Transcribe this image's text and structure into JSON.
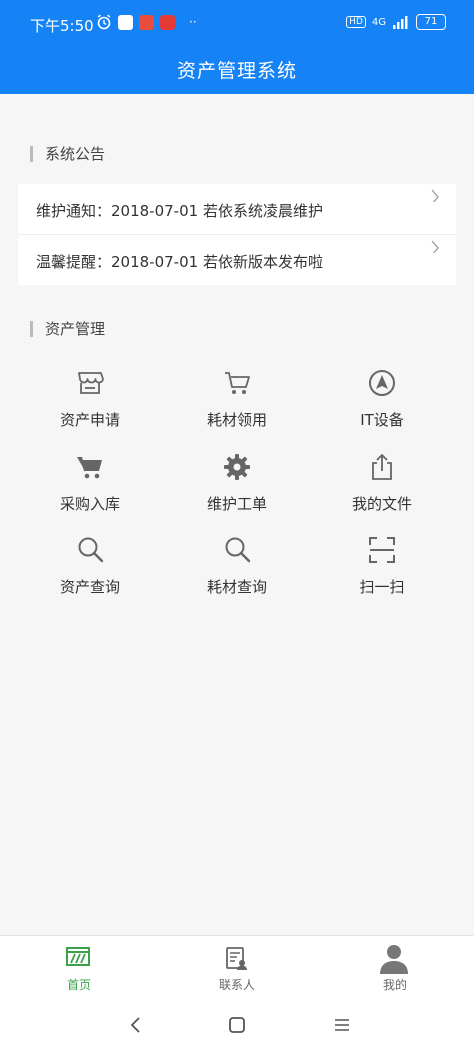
{
  "status": {
    "time": "下午5:50",
    "network": "4G",
    "battery": "71"
  },
  "app": {
    "title": "资产管理系统"
  },
  "notices": {
    "section_title": "系统公告",
    "items": [
      {
        "text": "维护通知：2018-07-01 若依系统凌晨维护"
      },
      {
        "text": "温馨提醒：2018-07-01 若依新版本发布啦"
      }
    ]
  },
  "assets": {
    "section_title": "资产管理",
    "items": [
      {
        "label": "资产申请",
        "icon": "store-icon"
      },
      {
        "label": "耗材领用",
        "icon": "cart-outline-icon"
      },
      {
        "label": "IT设备",
        "icon": "navigation-icon"
      },
      {
        "label": "采购入库",
        "icon": "cart-filled-icon"
      },
      {
        "label": "维护工单",
        "icon": "gear-icon"
      },
      {
        "label": "我的文件",
        "icon": "share-icon"
      },
      {
        "label": "资产查询",
        "icon": "search-icon"
      },
      {
        "label": "耗材查询",
        "icon": "search-icon"
      },
      {
        "label": "扫一扫",
        "icon": "scan-icon"
      }
    ]
  },
  "tabs": [
    {
      "label": "首页",
      "icon": "home-icon",
      "active": true
    },
    {
      "label": "联系人",
      "icon": "contacts-icon",
      "active": false
    },
    {
      "label": "我的",
      "icon": "profile-icon",
      "active": false
    }
  ],
  "colors": {
    "primary": "#1583f5",
    "tab_active": "#3aa34a",
    "tab_inactive": "#666666",
    "icon_gray": "#666666"
  }
}
